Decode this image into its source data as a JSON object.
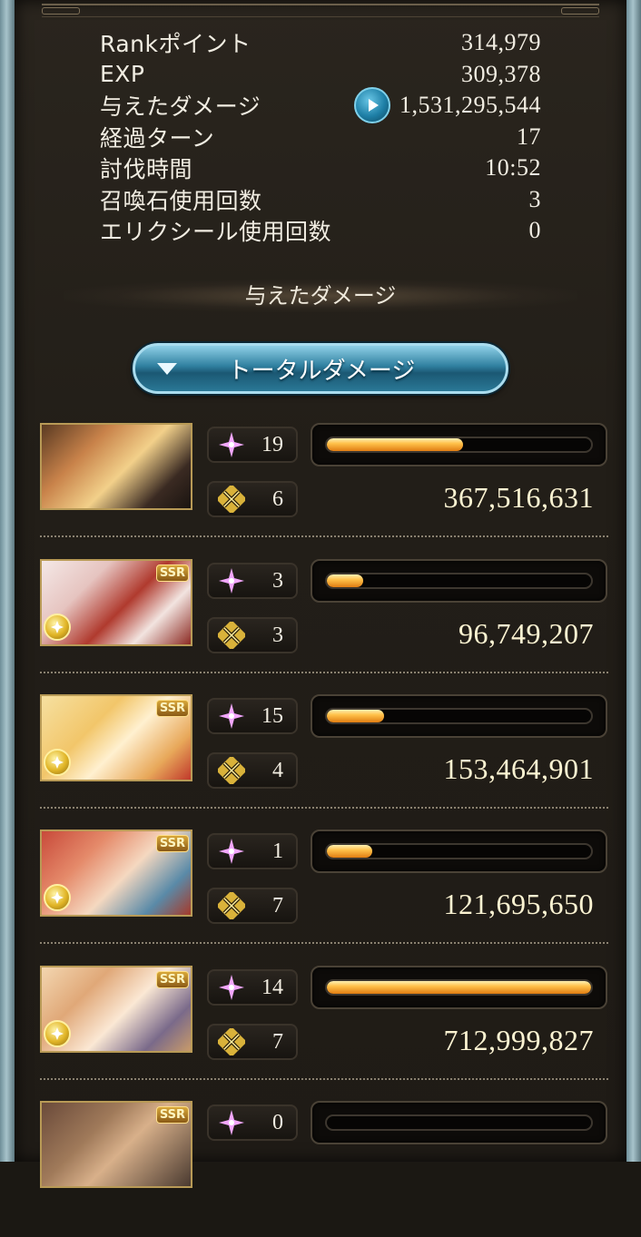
{
  "stats": [
    {
      "label": "Rankポイント",
      "value": "314,979"
    },
    {
      "label": "EXP",
      "value": "309,378"
    },
    {
      "label": "与えたダメージ",
      "value": "1,531,295,544",
      "has_play_button": true
    },
    {
      "label": "経過ターン",
      "value": "17"
    },
    {
      "label": "討伐時間",
      "value": "10:52"
    },
    {
      "label": "召喚石使用回数",
      "value": "3"
    },
    {
      "label": "エリクシール使用回数",
      "value": "0"
    }
  ],
  "section_title": "与えたダメージ",
  "filter_button": {
    "label": "トータルダメージ",
    "icon": "triangle-down-icon"
  },
  "characters": [
    {
      "ssr": "",
      "has_coin": false,
      "skill_count": "19",
      "ougi_count": "6",
      "damage": "367,516,631",
      "bar_fraction": 0.516
    },
    {
      "ssr": "SSR",
      "has_coin": true,
      "skill_count": "3",
      "ougi_count": "3",
      "damage": "96,749,207",
      "bar_fraction": 0.136
    },
    {
      "ssr": "SSR",
      "has_coin": true,
      "skill_count": "15",
      "ougi_count": "4",
      "damage": "153,464,901",
      "bar_fraction": 0.215
    },
    {
      "ssr": "SSR",
      "has_coin": true,
      "skill_count": "1",
      "ougi_count": "7",
      "damage": "121,695,650",
      "bar_fraction": 0.171
    },
    {
      "ssr": "SSR",
      "has_coin": true,
      "skill_count": "14",
      "ougi_count": "7",
      "damage": "712,999,827",
      "bar_fraction": 1.0
    },
    {
      "ssr": "SSR",
      "has_coin": false,
      "skill_count": "0",
      "ougi_count": "",
      "damage": "",
      "bar_fraction": 0.0
    }
  ],
  "colors": {
    "accent_blue": "#2f7f9f",
    "bar_gold": "#ffc14a",
    "frame_gold": "#b89a56"
  }
}
